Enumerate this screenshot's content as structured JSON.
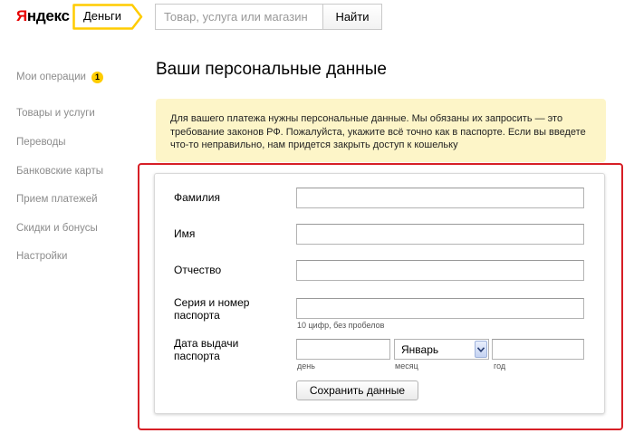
{
  "header": {
    "logo_red": "Я",
    "logo_rest": "ндекс",
    "service_tab": "Деньги",
    "search": {
      "placeholder": "Товар, услуга или магазин",
      "value": ""
    },
    "search_button": "Найти"
  },
  "sidebar": {
    "items": [
      {
        "label": "Мои операции",
        "badge": "1"
      },
      {
        "label": "Товары и услуги"
      },
      {
        "label": "Переводы"
      },
      {
        "label": "Банковские карты"
      },
      {
        "label": "Прием платежей"
      },
      {
        "label": "Скидки и бонусы"
      },
      {
        "label": "Настройки"
      }
    ]
  },
  "main": {
    "title": "Ваши персональные данные",
    "notice": "Для вашего платежа нужны персональные данные. Мы обязаны их запросить — это требование законов РФ. Пожалуйста, укажите всё точно как в паспорте. Если вы введете что-то неправильно, нам придется закрыть доступ к кошельку",
    "form": {
      "surname_label": "Фамилия",
      "name_label": "Имя",
      "patronymic_label": "Отчество",
      "passport_label_1": "Серия и номер",
      "passport_label_2": "паспорта",
      "passport_hint": "10 цифр, без пробелов",
      "issue_label_1": "Дата выдачи",
      "issue_label_2": "паспорта",
      "day_hint": "день",
      "month_hint": "месяц",
      "year_hint": "год",
      "month_value": "Январь",
      "save_button": "Сохранить данные"
    }
  },
  "colors": {
    "accent": "#ffcc00",
    "highlight": "#d71f26",
    "notice_bg": "#fdf5c8"
  }
}
